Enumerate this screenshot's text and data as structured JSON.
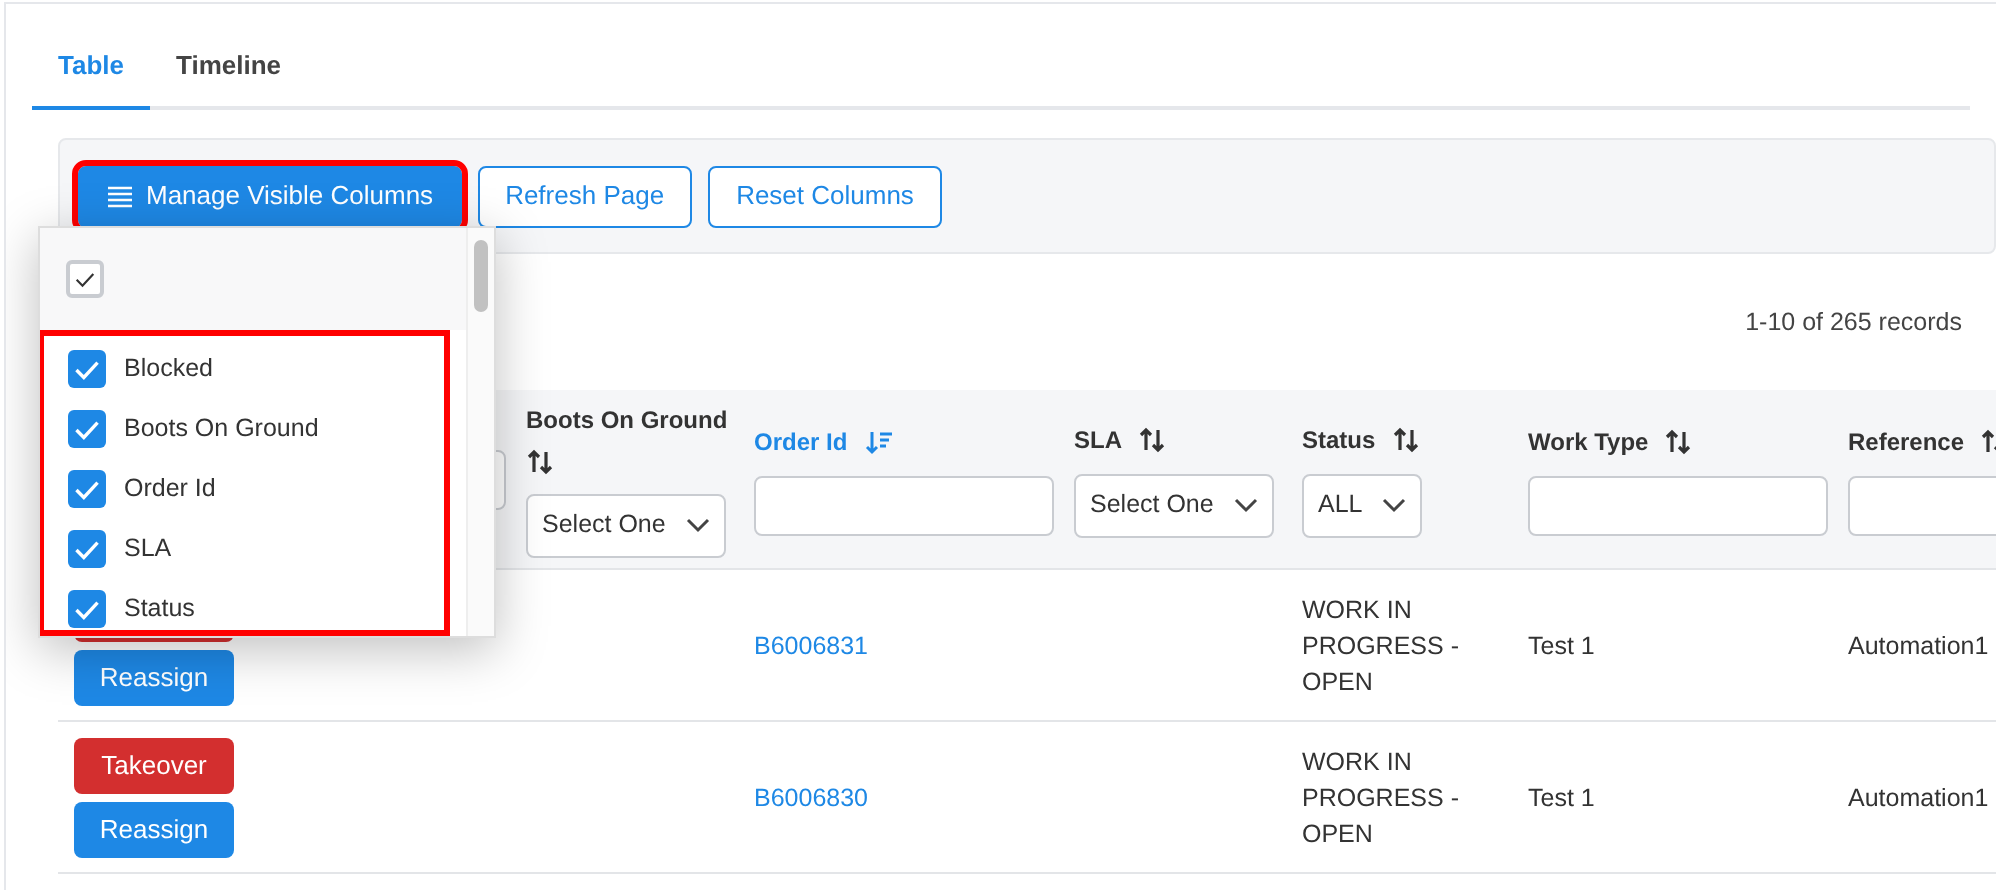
{
  "tabs": [
    {
      "label": "Table",
      "selected": true
    },
    {
      "label": "Timeline",
      "selected": false
    }
  ],
  "toolbar": {
    "buttons": [
      {
        "label": "Manage Visible Columns",
        "kind": "primary",
        "highlighted": true
      },
      {
        "label": "Refresh Page",
        "kind": "outline",
        "highlighted": false
      },
      {
        "label": "Reset Columns",
        "kind": "outline",
        "highlighted": false
      }
    ]
  },
  "column_menu": {
    "select_all": {
      "checked": true
    },
    "highlighted": true,
    "items": [
      {
        "label": "Blocked",
        "checked": true
      },
      {
        "label": "Boots On Ground",
        "checked": true
      },
      {
        "label": "Order Id",
        "checked": true
      },
      {
        "label": "SLA",
        "checked": true
      },
      {
        "label": "Status",
        "checked": true
      }
    ]
  },
  "records": "1-10 of 265 records",
  "table": {
    "columns": [
      {
        "filter": {
          "kind": "input"
        }
      },
      {
        "title": "Boots On Ground",
        "sorted": false,
        "filter": {
          "kind": "select",
          "value": "Select One"
        }
      },
      {
        "title": "Order Id",
        "sorted": true,
        "filter": {
          "kind": "input"
        }
      },
      {
        "title": "SLA",
        "sorted": false,
        "filter": {
          "kind": "select",
          "value": "Select One"
        }
      },
      {
        "title": "Status",
        "sorted": false,
        "filter": {
          "kind": "select",
          "value": "ALL"
        }
      },
      {
        "title": "Work Type",
        "sorted": false,
        "filter": {
          "kind": "input"
        }
      },
      {
        "title": "Reference",
        "sorted": false,
        "filter": {
          "kind": "input"
        }
      }
    ],
    "rows": [
      {
        "cells": [
          {
            "buttons": [
              {
                "kind": "takeover"
              },
              {
                "kind": "reassign",
                "label": "Reassign"
              }
            ]
          },
          "",
          "B6006831",
          "",
          "WORK IN PROGRESS - OPEN",
          "Test 1",
          "Automation1"
        ]
      },
      {
        "cells": [
          {
            "buttons": [
              {
                "kind": "takeover",
                "label": "Takeover"
              },
              {
                "kind": "reassign",
                "label": "Reassign"
              }
            ]
          },
          "",
          "B6006830",
          "",
          "WORK IN PROGRESS - OPEN",
          "Test 1",
          "Automation1"
        ]
      }
    ]
  }
}
